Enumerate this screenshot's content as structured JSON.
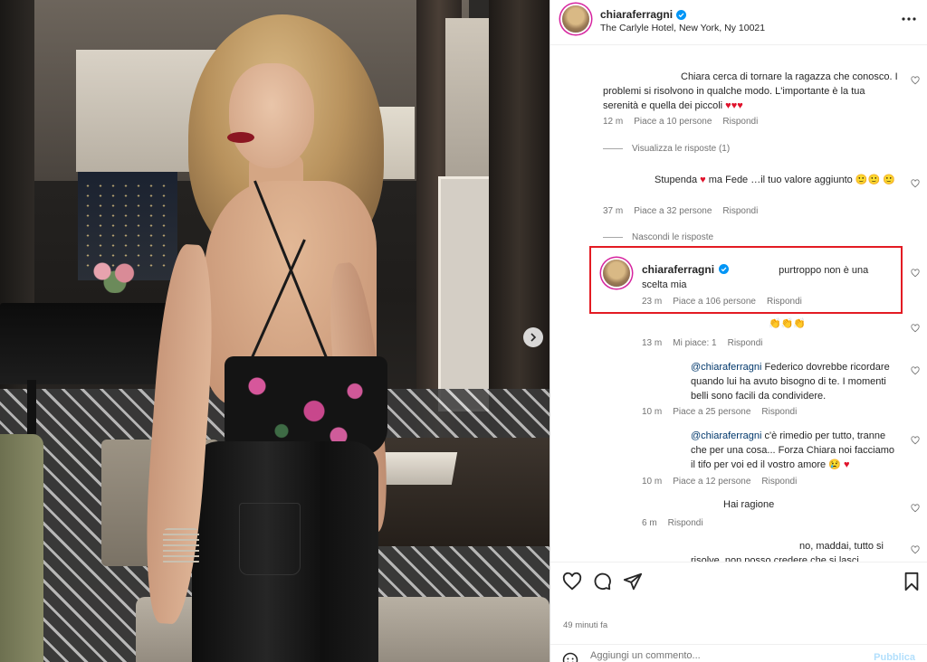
{
  "post": {
    "username": "chiaraferragni",
    "location": "The Carlyle Hotel, New York, Ny 10021"
  },
  "icons": {
    "verified": "verified-badge-icon",
    "more": "more-options-icon",
    "like": "heart-icon",
    "comment": "comment-bubble-icon",
    "share": "paper-plane-icon",
    "save": "bookmark-icon",
    "emoji": "emoji-smile-icon",
    "next": "chevron-right-icon"
  },
  "colors": {
    "accent_red": "#e31b23",
    "heart_red": "#e0122b",
    "mention_blue": "#00376b",
    "muted": "#737373"
  },
  "comments": [
    {
      "text": "Chiara cerca di tornare la ragazza che conosco. I problemi si risolvono in qualche modo. L'importante è la tua serenità e quella dei piccoli",
      "emoji": "♥♥♥",
      "time": "12 m",
      "likes": "Piace a 10 persone",
      "reply": "Rispondi",
      "view_replies": "Visualizza le risposte (1)"
    },
    {
      "text": "Stupenda",
      "text_b": "ma Fede …il tuo valore aggiunto",
      "time": "37 m",
      "likes": "Piace a 32 persone",
      "reply": "Rispondi",
      "hide_replies": "Nascondi le risposte"
    }
  ],
  "replies": [
    {
      "username": "chiaraferragni",
      "text": "purtroppo non è una scelta mia",
      "time": "23 m",
      "likes": "Piace a 106 persone",
      "reply": "Rispondi"
    },
    {
      "text": "👏👏👏",
      "time": "13 m",
      "likes": "Mi piace: 1",
      "reply": "Rispondi"
    },
    {
      "mention": "@chiaraferragni",
      "text": "Federico dovrebbe ricordare quando lui ha avuto bisogno di te. I momenti belli sono facili da condividere.",
      "time": "10 m",
      "likes": "Piace a 25 persone",
      "reply": "Rispondi"
    },
    {
      "mention": "@chiaraferragni",
      "text": "c'è rimedio per tutto, tranne che per una cosa... Forza Chiara noi facciamo il tifo per voi ed il vostro amore",
      "time": "10 m",
      "likes": "Piace a 12 persone",
      "reply": "Rispondi"
    },
    {
      "text": "Hai ragione",
      "time": "6 m",
      "reply": "Rispondi"
    },
    {
      "text": "no, maddai, tutto si risolve, non posso credere che si lasci scappare una"
    }
  ],
  "footer": {
    "time_ago": "49 minuti fa",
    "comment_placeholder": "Aggiungi un commento...",
    "publish": "Pubblica"
  }
}
